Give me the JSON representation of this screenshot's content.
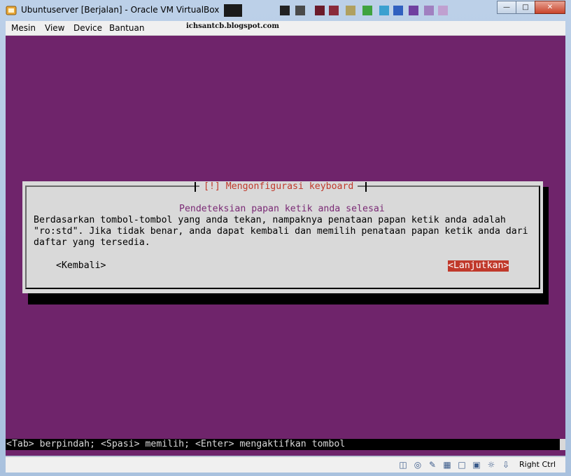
{
  "window": {
    "title": "Ubuntuserver [Berjalan] - Oracle VM VirtualBox",
    "controls": [
      "minimize",
      "maximize",
      "close"
    ]
  },
  "menubar": {
    "items": [
      "Mesin",
      "View",
      "Device",
      "Bantuan"
    ],
    "watermark": "ichsantcb.blogspot.com"
  },
  "dialog": {
    "title": "[!] Mengonfigurasi keyboard",
    "subtitle": "Pendeteksian papan ketik anda selesai",
    "body_lines": [
      "Berdasarkan tombol-tombol yang anda tekan, nampaknya penataan papan ketik anda adalah",
      "\"ro:std\". Jika tidak benar, anda dapat kembali dan memilih penataan papan ketik anda dari",
      "daftar yang tersedia."
    ],
    "back_button": "<Kembali>",
    "continue_button": "<Lanjutkan>"
  },
  "screen_status": "<Tab> berpindah; <Spasi> memilih; <Enter> mengaktifkan tombol",
  "statusbar": {
    "icons": [
      "hard-disk-icon",
      "optical-drive-icon",
      "usb-icon",
      "network-icon",
      "shared-folder-icon",
      "display-icon",
      "mouse-integration-icon",
      "host-key-icon"
    ],
    "host_key": "Right Ctrl"
  },
  "colors": {
    "screen_bg": "#6f246b",
    "dialog_bg": "#d9d9d9",
    "accent": "#c0392b"
  }
}
